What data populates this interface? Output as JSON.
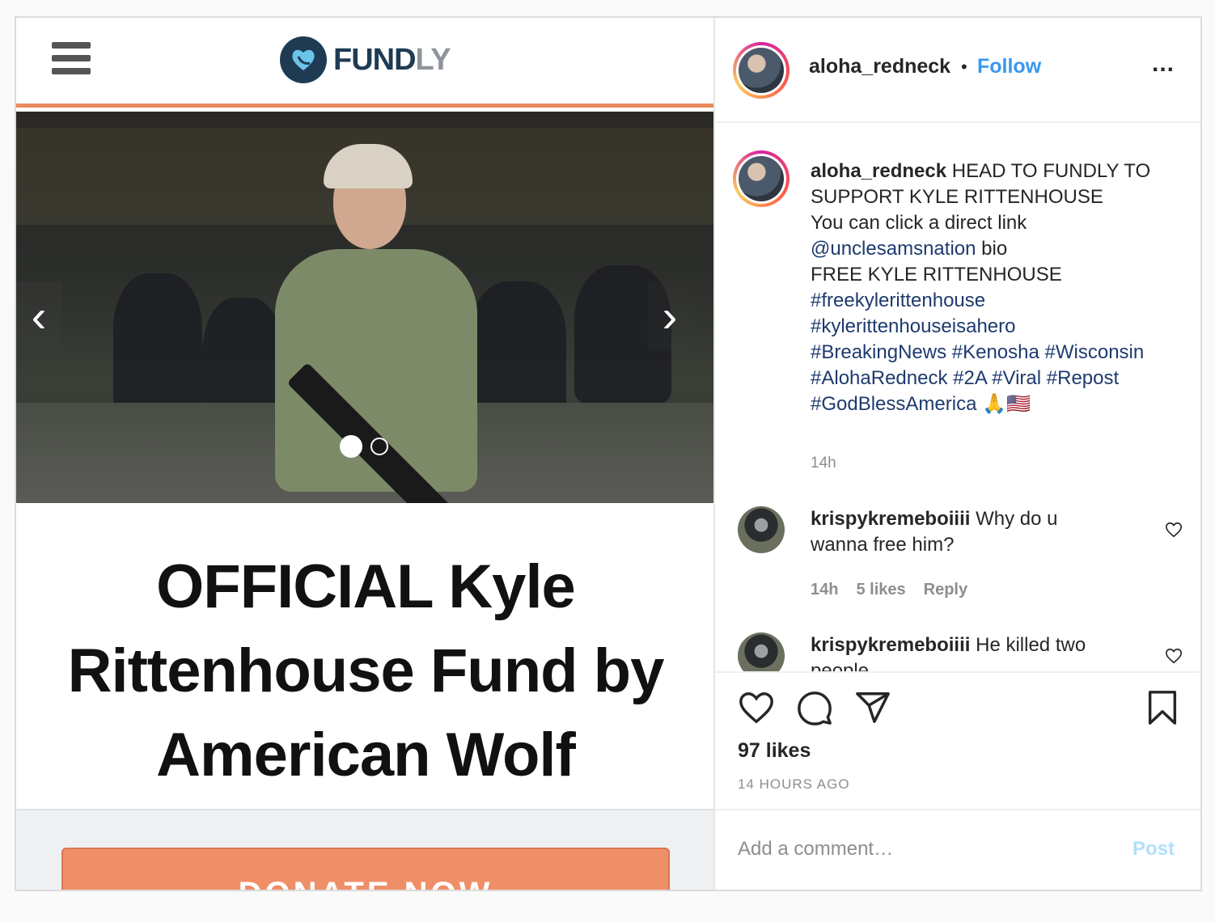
{
  "media": {
    "logo_text_dark": "FUND",
    "logo_text_light": "LY",
    "fund_title_lines": [
      "OFFICIAL Kyle",
      "Rittenhouse Fund by",
      "American Wolf"
    ],
    "donate_label": "DONATE NOW",
    "carousel": {
      "total": 2,
      "current": 1
    }
  },
  "header": {
    "username": "aloha_redneck",
    "separator": "•",
    "follow": "Follow",
    "more": "..."
  },
  "caption": {
    "username": "aloha_redneck",
    "line1": "HEAD TO FUNDLY TO SUPPORT KYLE RITTENHOUSE",
    "line2": "You can click a direct link",
    "mention": "@unclesamsnation",
    "line3_rest": "bio",
    "line4": "FREE KYLE RITTENHOUSE",
    "tags1": "#freekylerittenhouse",
    "tags2": "#kylerittenhouseisahero",
    "tags3": "#BreakingNews #Kenosha #Wisconsin",
    "tags4": "#AlohaRedneck #2A #Viral #Repost",
    "tags5": "#GodBlessAmerica",
    "emoji": "🙏🇺🇸",
    "time": "14h"
  },
  "comments": [
    {
      "username": "krispykremeboiiii",
      "text": "Why do u wanna free him?",
      "time": "14h",
      "likes": "5 likes",
      "reply": "Reply"
    },
    {
      "username": "krispykremeboiiii",
      "text": "He killed two people"
    }
  ],
  "actions": {
    "likes": "97 likes",
    "posted_ago": "14 HOURS AGO"
  },
  "add_comment": {
    "placeholder": "Add a comment…",
    "post": "Post"
  },
  "colors": {
    "follow": "#3897f0",
    "hashtag": "#1e3a6e",
    "post_disabled": "#b2dffc",
    "fundly_orange": "#ef8f68"
  },
  "icons": [
    "hamburger-icon",
    "fundly-logo",
    "chevron-left-icon",
    "chevron-right-icon",
    "heart-icon",
    "comment-icon",
    "share-icon",
    "bookmark-icon",
    "more-icon"
  ]
}
